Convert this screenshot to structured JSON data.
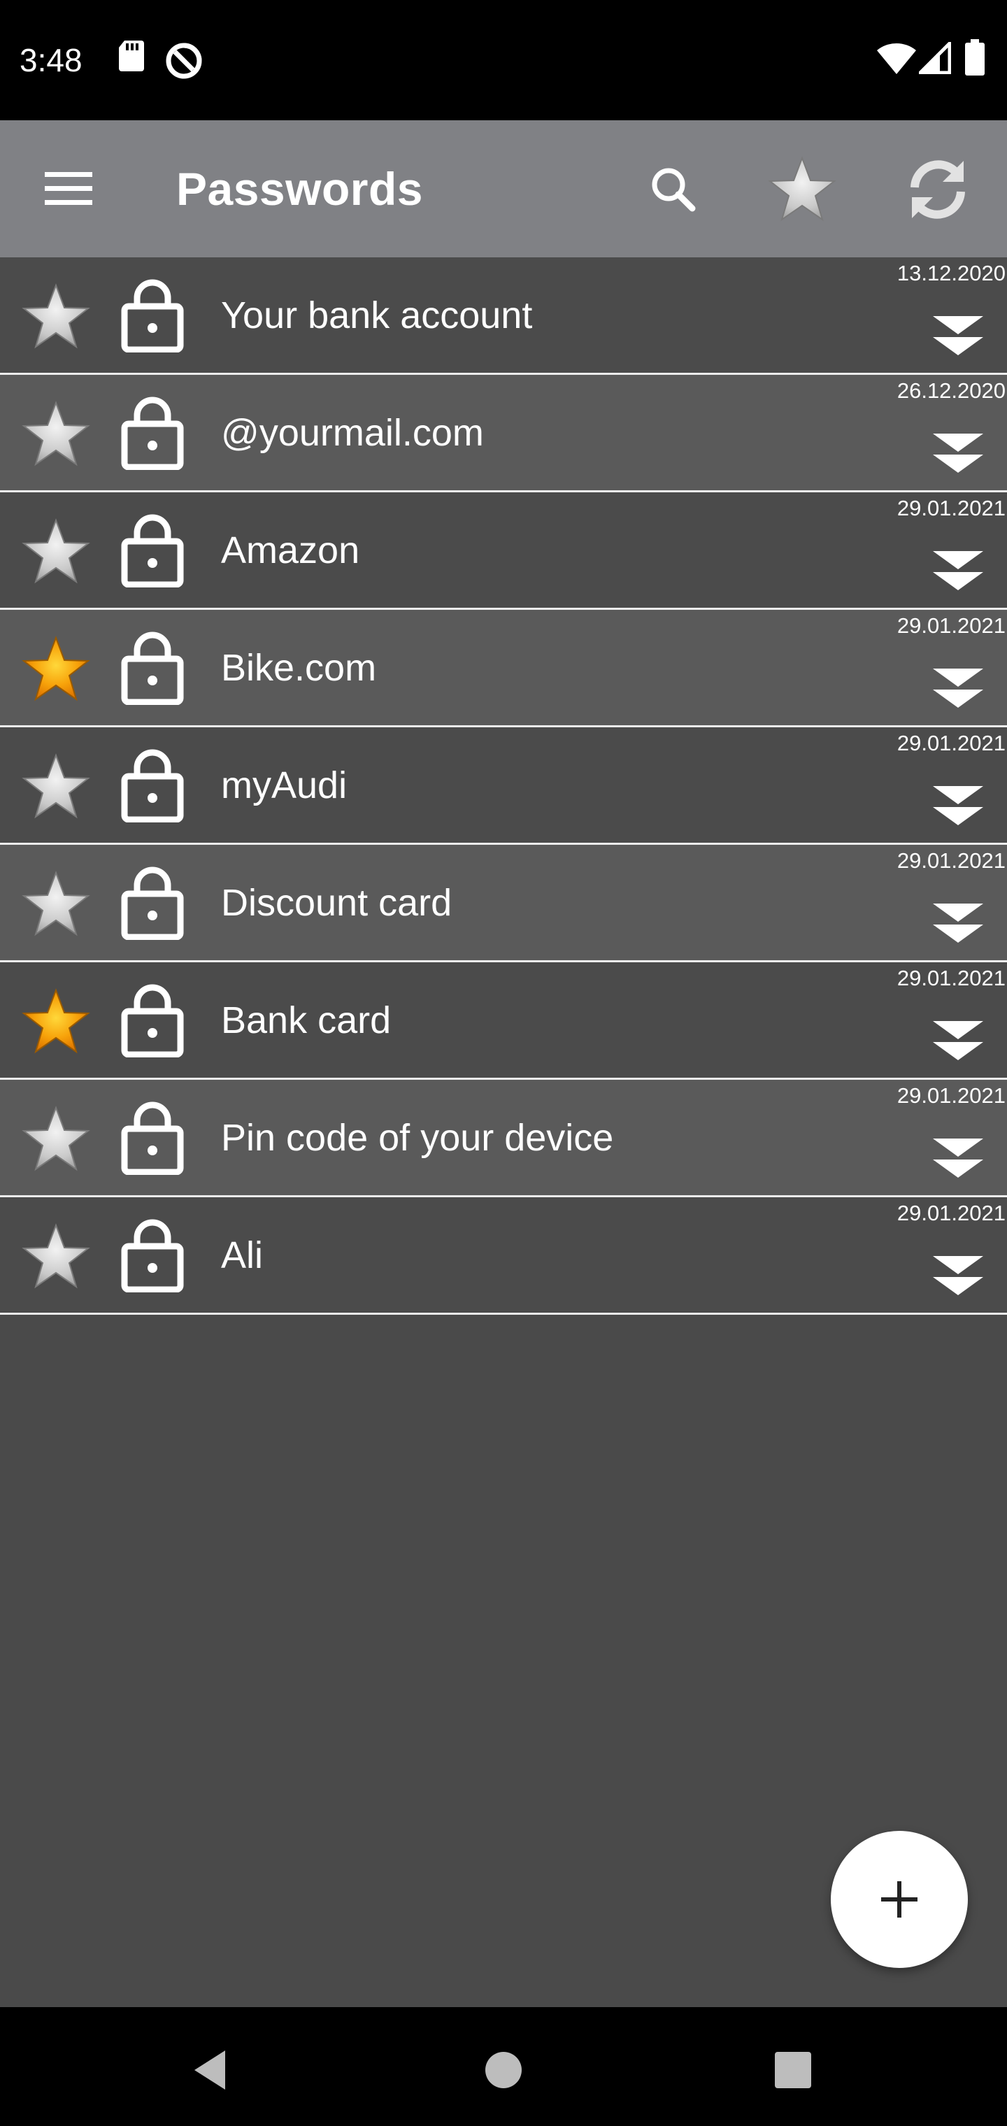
{
  "status_bar": {
    "time": "3:48",
    "icons": [
      "sd-card-icon",
      "no-data-saver-icon",
      "wifi-icon",
      "cell-signal-icon",
      "battery-icon"
    ]
  },
  "app_bar": {
    "title": "Passwords",
    "icons": [
      "menu-icon",
      "search-icon",
      "star-icon",
      "refresh-icon"
    ]
  },
  "entries": [
    {
      "title": "Your bank account",
      "date": "13.12.2020",
      "favorite": false
    },
    {
      "title": "@yourmail.com",
      "date": "26.12.2020",
      "favorite": false
    },
    {
      "title": "Amazon",
      "date": "29.01.2021",
      "favorite": false
    },
    {
      "title": "Bike.com",
      "date": "29.01.2021",
      "favorite": true
    },
    {
      "title": "myAudi",
      "date": "29.01.2021",
      "favorite": false
    },
    {
      "title": "Discount card",
      "date": "29.01.2021",
      "favorite": false
    },
    {
      "title": "Bank card",
      "date": "29.01.2021",
      "favorite": true
    },
    {
      "title": "Pin code of your device",
      "date": "29.01.2021",
      "favorite": false
    },
    {
      "title": "Ali",
      "date": "29.01.2021",
      "favorite": false
    }
  ],
  "fab": {
    "icon": "plus-icon"
  },
  "nav_bar": {
    "icons": [
      "back-icon",
      "home-icon",
      "recents-icon"
    ]
  },
  "colors": {
    "app_bar": "#808185",
    "row_dark": "#4b4b4b",
    "row_light": "#5a5a5a",
    "background": "#4a4a4a",
    "favorite_star": "#f5a300",
    "inactive_star": "#d8d8d8"
  }
}
